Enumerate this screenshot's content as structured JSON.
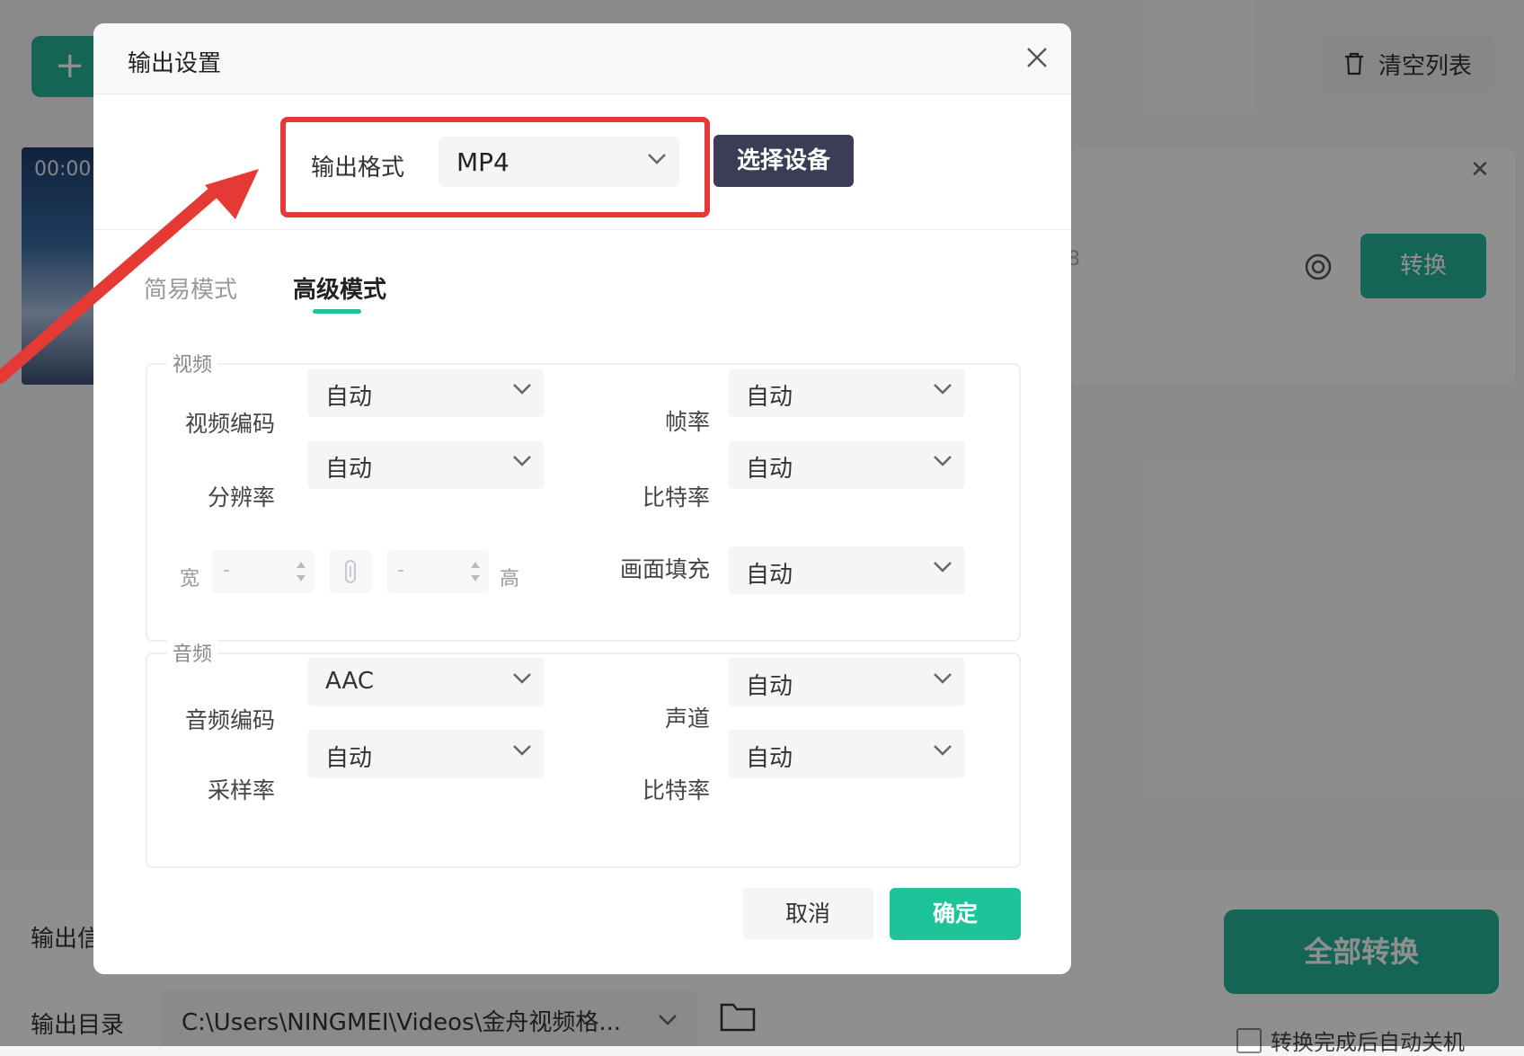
{
  "app": {
    "add_label": "+",
    "clear_list_label": "清空列表",
    "file": {
      "time": "00:00:",
      "meta_fragment": "8",
      "convert_label": "转换"
    },
    "bottom": {
      "output_info_label": "输出信",
      "output_dir_label": "输出目录",
      "output_dir_value": "C:\\Users\\NINGMEI\\Videos\\金舟视频格...",
      "convert_all_label": "全部转换",
      "auto_shutdown_label": "转换完成后自动关机"
    }
  },
  "dialog": {
    "title": "输出设置",
    "format_label": "输出格式",
    "format_value": "MP4",
    "select_device_label": "选择设备",
    "tabs": [
      {
        "label": "简易模式"
      },
      {
        "label": "高级模式"
      }
    ],
    "video": {
      "group_title": "视频",
      "codec_label": "视频编码",
      "codec_value": "自动",
      "framerate_label": "帧率",
      "framerate_value": "自动",
      "resolution_label": "分辨率",
      "resolution_value": "自动",
      "bitrate_label": "比特率",
      "bitrate_value": "自动",
      "width_label": "宽",
      "width_value": "-",
      "height_label": "高",
      "height_value": "-",
      "fill_label": "画面填充",
      "fill_value": "自动"
    },
    "audio": {
      "group_title": "音频",
      "codec_label": "音频编码",
      "codec_value": "AAC",
      "channel_label": "声道",
      "channel_value": "自动",
      "samplerate_label": "采样率",
      "samplerate_value": "自动",
      "bitrate_label": "比特率",
      "bitrate_value": "自动"
    },
    "cancel_label": "取消",
    "ok_label": "确定"
  },
  "colors": {
    "accent": "#1fc39a",
    "annotation": "#e53935",
    "device_button": "#3a3d55"
  }
}
